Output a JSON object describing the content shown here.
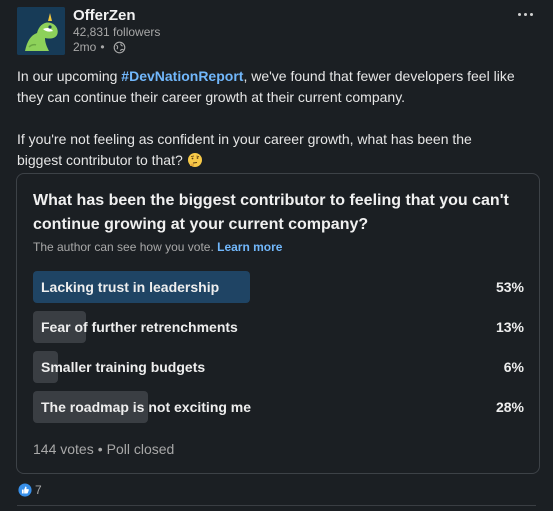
{
  "author": {
    "name": "OfferZen",
    "followers": "42,831 followers",
    "age": "2mo",
    "dot": "•",
    "visibility_icon": "globe-icon",
    "avatar_icon": "dinosaur-logo-icon"
  },
  "post": {
    "line1_pre": "In our upcoming ",
    "hashtag": "#DevNationReport",
    "line1_post": ", we've found that fewer developers feel like they can continue their career growth at their current company.",
    "line2": "If you're not feeling as confident in your career growth, what has been the biggest contributor to that?",
    "emoji": "thinking-face-icon"
  },
  "poll": {
    "question": "What has been the biggest contributor to feeling that you can't continue growing at your current company?",
    "note": "The author can see how you vote.",
    "learn_more": "Learn more",
    "options": [
      {
        "label": "Lacking trust in leadership",
        "percent_label": "53%",
        "percent": 53
      },
      {
        "label": "Fear of further retrenchments",
        "percent_label": "13%",
        "percent": 13
      },
      {
        "label": "Smaller training budgets",
        "percent_label": "6%",
        "percent": 6
      },
      {
        "label": "The roadmap is not exciting me",
        "percent_label": "28%",
        "percent": 28
      }
    ],
    "votes": "144 votes",
    "separator": "•",
    "status": "Poll closed"
  },
  "reactions": {
    "icon": "like-icon",
    "count": "7"
  },
  "colors": {
    "background": "#1b1f23",
    "link": "#71b7fb",
    "leading_option": "#1f4464",
    "option": "#3a3e43",
    "avatar_bg": "#173b57",
    "avatar_dino": "#8dd15a"
  }
}
